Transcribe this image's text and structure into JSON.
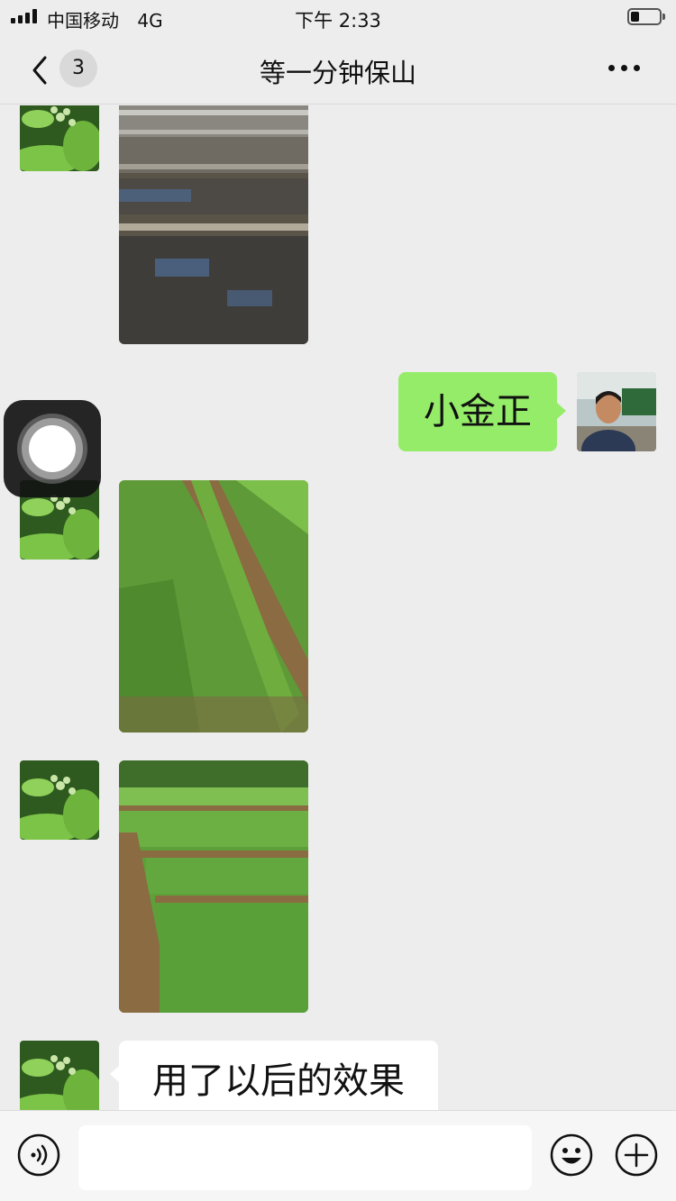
{
  "status_bar": {
    "carrier": "中国移动",
    "network": "4G",
    "time": "下午 2:33"
  },
  "header": {
    "unread_count": "3",
    "title": "等一分钟保山"
  },
  "messages": [
    {
      "sender": "other",
      "kind": "image",
      "description_icon": "muddy-field-photo"
    },
    {
      "sender": "me",
      "kind": "text",
      "text": "小金正"
    },
    {
      "sender": "other",
      "kind": "image",
      "description_icon": "green-field-photo"
    },
    {
      "sender": "other",
      "kind": "image",
      "description_icon": "green-terrace-photo"
    },
    {
      "sender": "other",
      "kind": "text",
      "text": "用了以后的效果"
    }
  ],
  "input_bar": {
    "placeholder": "",
    "icons": [
      "voice-icon",
      "emoji-icon",
      "plus-icon"
    ]
  },
  "colors": {
    "background": "#ededed",
    "my_bubble": "#95ec69",
    "their_bubble": "#ffffff"
  }
}
